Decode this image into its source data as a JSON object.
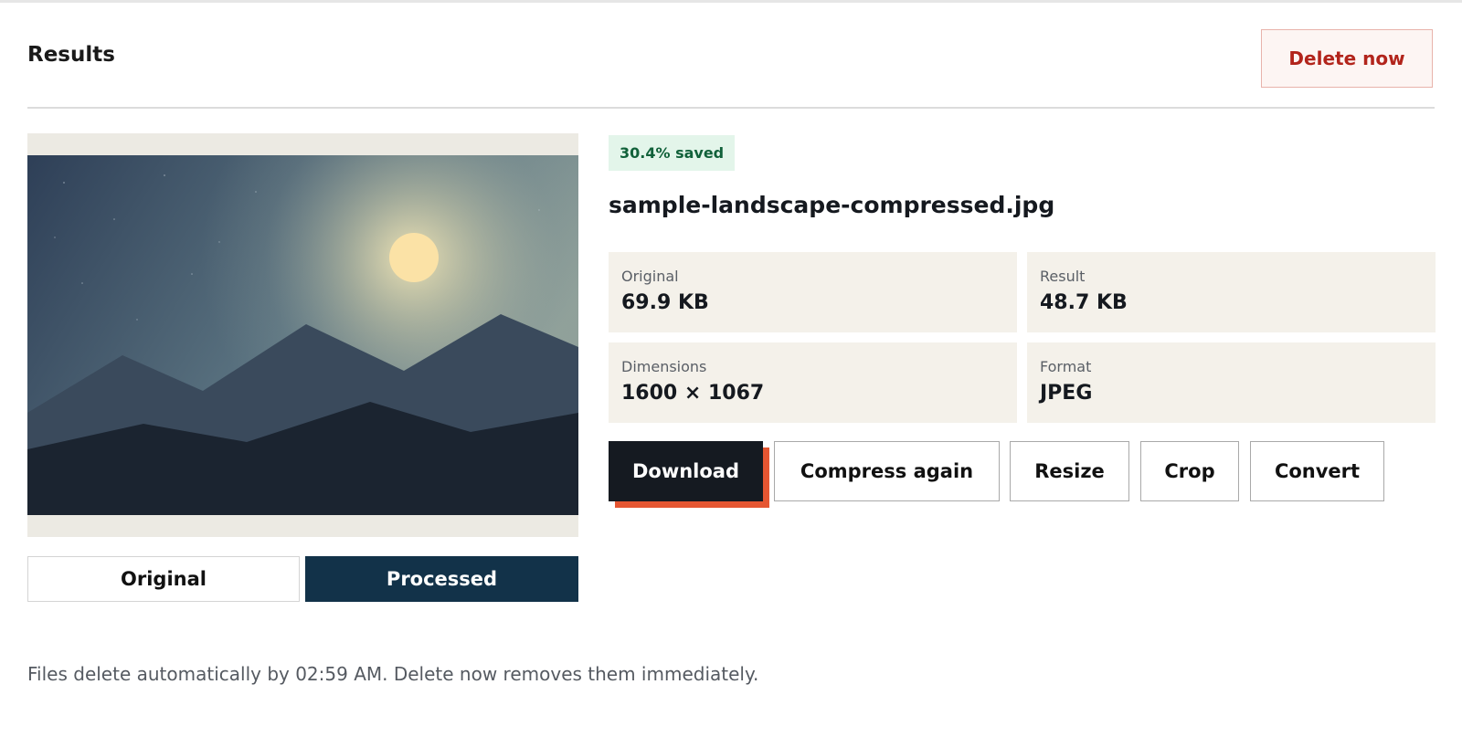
{
  "header": {
    "title": "Results",
    "delete_label": "Delete now"
  },
  "preview": {
    "toggle_original": "Original",
    "toggle_processed": "Processed",
    "active_view": "Processed"
  },
  "file": {
    "saved_badge": "30.4% saved",
    "name": "sample-landscape-compressed.jpg"
  },
  "stats": {
    "original": {
      "label": "Original",
      "value": "69.9 KB"
    },
    "result": {
      "label": "Result",
      "value": "48.7 KB"
    },
    "dimensions": {
      "label": "Dimensions",
      "value": "1600 × 1067"
    },
    "format": {
      "label": "Format",
      "value": "JPEG"
    }
  },
  "actions": {
    "download": "Download",
    "compress_again": "Compress again",
    "resize": "Resize",
    "crop": "Crop",
    "convert": "Convert"
  },
  "footer": {
    "note": "Files delete automatically by 02:59 AM. Delete now removes them immediately."
  },
  "colors": {
    "delete_text": "#b2241b",
    "processed_active": "#123249",
    "download_bg": "#151a21",
    "download_accent": "#e55632",
    "saved_badge_bg": "#e3f5ea",
    "saved_badge_text": "#11613a",
    "stat_card_bg": "#f4f1ea"
  }
}
